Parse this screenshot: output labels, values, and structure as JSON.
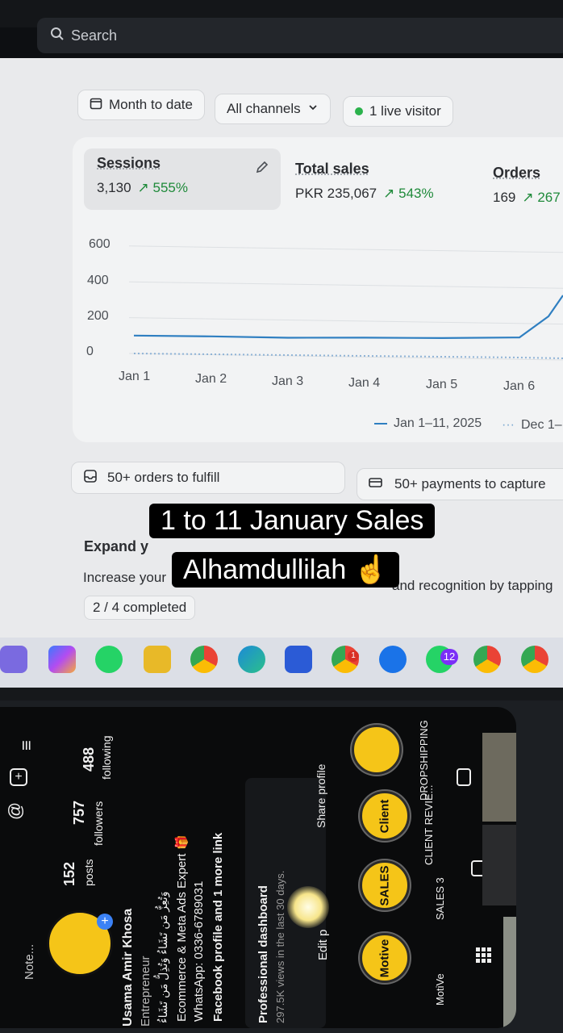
{
  "search": {
    "label": "Search"
  },
  "filters": {
    "date_range": "Month to date",
    "channels": "All channels",
    "live": "1 live visitor"
  },
  "metrics": [
    {
      "label": "Sessions",
      "value": "3,130",
      "change": "↗ 555%"
    },
    {
      "label": "Total sales",
      "value": "PKR 235,067",
      "change": "↗ 543%"
    },
    {
      "label": "Orders",
      "value": "169",
      "change": "↗ 267"
    }
  ],
  "chart_data": {
    "type": "line",
    "x": [
      "Jan 1",
      "Jan 2",
      "Jan 3",
      "Jan 4",
      "Jan 5",
      "Jan 6"
    ],
    "ylim": [
      0,
      600
    ],
    "yticks": [
      "600",
      "400",
      "200",
      "0"
    ],
    "series": [
      {
        "name": "Jan 1–11, 2025",
        "values": [
          100,
          100,
          97,
          102,
          104,
          112
        ]
      },
      {
        "name": "Dec 1–",
        "values": [
          0,
          0,
          0,
          0,
          0,
          0
        ]
      }
    ],
    "legend": [
      "Jan 1–11, 2025",
      "Dec 1–"
    ]
  },
  "tasks": {
    "orders": "50+ orders to fulfill",
    "payments": "50+ payments to capture"
  },
  "setup": {
    "title": "Expand y",
    "desc_left": "Increase your",
    "desc_right": "and recognition by tapping",
    "progress": "2 / 4 completed"
  },
  "overlay": {
    "line1": "1 to 11 January Sales",
    "line2": "Alhamdullilah ☝️"
  },
  "taskbar": {
    "whatsapp_badge": "12",
    "chrome_badge": "1"
  },
  "profile": {
    "note": "Note...",
    "posts_count": "152",
    "posts_label": "posts",
    "followers_count": "757",
    "followers_label": "followers",
    "following_count": "488",
    "following_label": "following",
    "name": "Usama Amir Khosa",
    "category": "Entrepreneur",
    "arabic_line": "وَتُعِزُّ مَن تَشَاءُ وَتُذِلُّ مَن تَشَاءُ",
    "bio1": "Ecommerce & Meta Ads Expert 🎁",
    "bio2": "WhatsApp: 0336-6789031",
    "links": "Facebook profile and 1 more link",
    "dashboard": "Professional dashboard",
    "views": "297.5K views in the last 30 days.",
    "edit": "Edit p",
    "share": "Share profile",
    "highlights": [
      {
        "name": "Motive",
        "label": "MotiVe"
      },
      {
        "name": "SALES",
        "label": "SALES 3"
      },
      {
        "name": "Client",
        "label": "CLIENT REVIE..."
      },
      {
        "name": "",
        "label": "DROPSHIPPING"
      }
    ]
  }
}
